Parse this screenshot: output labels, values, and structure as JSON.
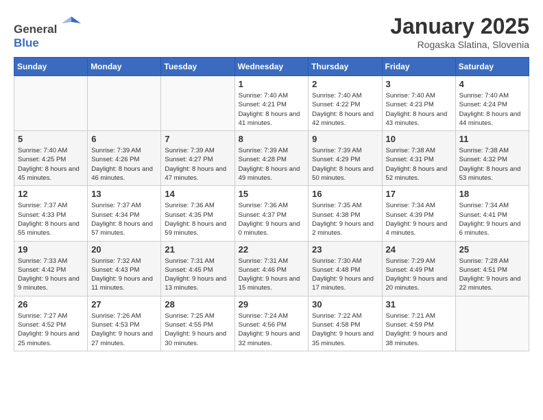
{
  "header": {
    "logo_general": "General",
    "logo_blue": "Blue",
    "title": "January 2025",
    "location": "Rogaska Slatina, Slovenia"
  },
  "weekdays": [
    "Sunday",
    "Monday",
    "Tuesday",
    "Wednesday",
    "Thursday",
    "Friday",
    "Saturday"
  ],
  "weeks": [
    [
      {
        "day": "",
        "sunrise": "",
        "sunset": "",
        "daylight": ""
      },
      {
        "day": "",
        "sunrise": "",
        "sunset": "",
        "daylight": ""
      },
      {
        "day": "",
        "sunrise": "",
        "sunset": "",
        "daylight": ""
      },
      {
        "day": "1",
        "sunrise": "Sunrise: 7:40 AM",
        "sunset": "Sunset: 4:21 PM",
        "daylight": "Daylight: 8 hours and 41 minutes."
      },
      {
        "day": "2",
        "sunrise": "Sunrise: 7:40 AM",
        "sunset": "Sunset: 4:22 PM",
        "daylight": "Daylight: 8 hours and 42 minutes."
      },
      {
        "day": "3",
        "sunrise": "Sunrise: 7:40 AM",
        "sunset": "Sunset: 4:23 PM",
        "daylight": "Daylight: 8 hours and 43 minutes."
      },
      {
        "day": "4",
        "sunrise": "Sunrise: 7:40 AM",
        "sunset": "Sunset: 4:24 PM",
        "daylight": "Daylight: 8 hours and 44 minutes."
      }
    ],
    [
      {
        "day": "5",
        "sunrise": "Sunrise: 7:40 AM",
        "sunset": "Sunset: 4:25 PM",
        "daylight": "Daylight: 8 hours and 45 minutes."
      },
      {
        "day": "6",
        "sunrise": "Sunrise: 7:39 AM",
        "sunset": "Sunset: 4:26 PM",
        "daylight": "Daylight: 8 hours and 46 minutes."
      },
      {
        "day": "7",
        "sunrise": "Sunrise: 7:39 AM",
        "sunset": "Sunset: 4:27 PM",
        "daylight": "Daylight: 8 hours and 47 minutes."
      },
      {
        "day": "8",
        "sunrise": "Sunrise: 7:39 AM",
        "sunset": "Sunset: 4:28 PM",
        "daylight": "Daylight: 8 hours and 49 minutes."
      },
      {
        "day": "9",
        "sunrise": "Sunrise: 7:39 AM",
        "sunset": "Sunset: 4:29 PM",
        "daylight": "Daylight: 8 hours and 50 minutes."
      },
      {
        "day": "10",
        "sunrise": "Sunrise: 7:38 AM",
        "sunset": "Sunset: 4:31 PM",
        "daylight": "Daylight: 8 hours and 52 minutes."
      },
      {
        "day": "11",
        "sunrise": "Sunrise: 7:38 AM",
        "sunset": "Sunset: 4:32 PM",
        "daylight": "Daylight: 8 hours and 53 minutes."
      }
    ],
    [
      {
        "day": "12",
        "sunrise": "Sunrise: 7:37 AM",
        "sunset": "Sunset: 4:33 PM",
        "daylight": "Daylight: 8 hours and 55 minutes."
      },
      {
        "day": "13",
        "sunrise": "Sunrise: 7:37 AM",
        "sunset": "Sunset: 4:34 PM",
        "daylight": "Daylight: 8 hours and 57 minutes."
      },
      {
        "day": "14",
        "sunrise": "Sunrise: 7:36 AM",
        "sunset": "Sunset: 4:35 PM",
        "daylight": "Daylight: 8 hours and 59 minutes."
      },
      {
        "day": "15",
        "sunrise": "Sunrise: 7:36 AM",
        "sunset": "Sunset: 4:37 PM",
        "daylight": "Daylight: 9 hours and 0 minutes."
      },
      {
        "day": "16",
        "sunrise": "Sunrise: 7:35 AM",
        "sunset": "Sunset: 4:38 PM",
        "daylight": "Daylight: 9 hours and 2 minutes."
      },
      {
        "day": "17",
        "sunrise": "Sunrise: 7:34 AM",
        "sunset": "Sunset: 4:39 PM",
        "daylight": "Daylight: 9 hours and 4 minutes."
      },
      {
        "day": "18",
        "sunrise": "Sunrise: 7:34 AM",
        "sunset": "Sunset: 4:41 PM",
        "daylight": "Daylight: 9 hours and 6 minutes."
      }
    ],
    [
      {
        "day": "19",
        "sunrise": "Sunrise: 7:33 AM",
        "sunset": "Sunset: 4:42 PM",
        "daylight": "Daylight: 9 hours and 9 minutes."
      },
      {
        "day": "20",
        "sunrise": "Sunrise: 7:32 AM",
        "sunset": "Sunset: 4:43 PM",
        "daylight": "Daylight: 9 hours and 11 minutes."
      },
      {
        "day": "21",
        "sunrise": "Sunrise: 7:31 AM",
        "sunset": "Sunset: 4:45 PM",
        "daylight": "Daylight: 9 hours and 13 minutes."
      },
      {
        "day": "22",
        "sunrise": "Sunrise: 7:31 AM",
        "sunset": "Sunset: 4:46 PM",
        "daylight": "Daylight: 9 hours and 15 minutes."
      },
      {
        "day": "23",
        "sunrise": "Sunrise: 7:30 AM",
        "sunset": "Sunset: 4:48 PM",
        "daylight": "Daylight: 9 hours and 17 minutes."
      },
      {
        "day": "24",
        "sunrise": "Sunrise: 7:29 AM",
        "sunset": "Sunset: 4:49 PM",
        "daylight": "Daylight: 9 hours and 20 minutes."
      },
      {
        "day": "25",
        "sunrise": "Sunrise: 7:28 AM",
        "sunset": "Sunset: 4:51 PM",
        "daylight": "Daylight: 9 hours and 22 minutes."
      }
    ],
    [
      {
        "day": "26",
        "sunrise": "Sunrise: 7:27 AM",
        "sunset": "Sunset: 4:52 PM",
        "daylight": "Daylight: 9 hours and 25 minutes."
      },
      {
        "day": "27",
        "sunrise": "Sunrise: 7:26 AM",
        "sunset": "Sunset: 4:53 PM",
        "daylight": "Daylight: 9 hours and 27 minutes."
      },
      {
        "day": "28",
        "sunrise": "Sunrise: 7:25 AM",
        "sunset": "Sunset: 4:55 PM",
        "daylight": "Daylight: 9 hours and 30 minutes."
      },
      {
        "day": "29",
        "sunrise": "Sunrise: 7:24 AM",
        "sunset": "Sunset: 4:56 PM",
        "daylight": "Daylight: 9 hours and 32 minutes."
      },
      {
        "day": "30",
        "sunrise": "Sunrise: 7:22 AM",
        "sunset": "Sunset: 4:58 PM",
        "daylight": "Daylight: 9 hours and 35 minutes."
      },
      {
        "day": "31",
        "sunrise": "Sunrise: 7:21 AM",
        "sunset": "Sunset: 4:59 PM",
        "daylight": "Daylight: 9 hours and 38 minutes."
      },
      {
        "day": "",
        "sunrise": "",
        "sunset": "",
        "daylight": ""
      }
    ]
  ]
}
